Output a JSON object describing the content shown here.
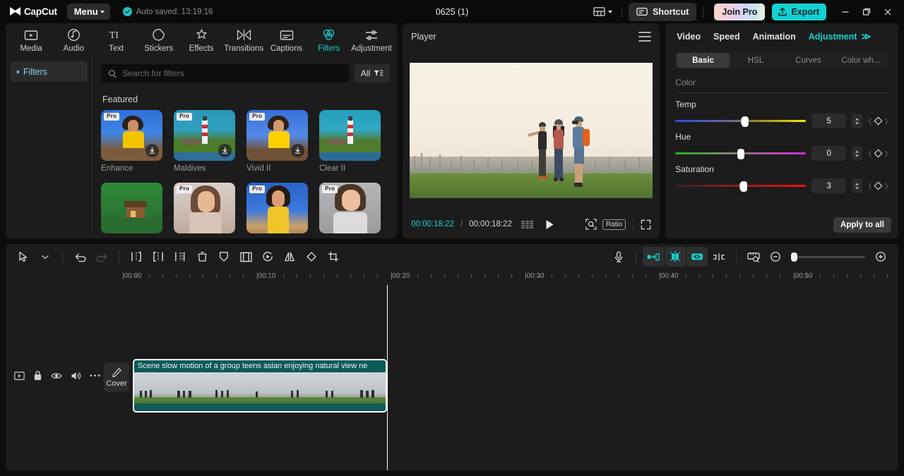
{
  "titlebar": {
    "app_name": "CapCut",
    "menu_label": "Menu",
    "autosave_text": "Auto saved: 13:19:16",
    "project_title": "0625 (1)",
    "layout_icon": "layout-icon",
    "shortcut_label": "Shortcut",
    "join_pro_label": "Join Pro",
    "export_label": "Export",
    "minimize_icon": "minimize-icon",
    "maximize_icon": "maximize-icon",
    "close_icon": "close-icon"
  },
  "left_panel": {
    "tabs": [
      {
        "label": "Media",
        "icon": "media-icon",
        "active": false
      },
      {
        "label": "Audio",
        "icon": "audio-icon",
        "active": false
      },
      {
        "label": "Text",
        "icon": "text-icon",
        "active": false
      },
      {
        "label": "Stickers",
        "icon": "stickers-icon",
        "active": false
      },
      {
        "label": "Effects",
        "icon": "effects-icon",
        "active": false
      },
      {
        "label": "Transitions",
        "icon": "transitions-icon",
        "active": false
      },
      {
        "label": "Captions",
        "icon": "captions-icon",
        "active": false
      },
      {
        "label": "Filters",
        "icon": "filters-icon",
        "active": true
      },
      {
        "label": "Adjustment",
        "icon": "adjustment-icon",
        "active": false
      }
    ],
    "categories": [
      {
        "label": "Filters",
        "active": true
      }
    ],
    "search": {
      "placeholder": "Search for filters",
      "value": ""
    },
    "filter_button": {
      "label": "All",
      "icon": "filter-sort-icon"
    },
    "section_title": "Featured",
    "filters": [
      {
        "name": "Enhance",
        "pro": true,
        "downloadable": true,
        "scene": "sc-portrait-blue"
      },
      {
        "name": "Maldives",
        "pro": true,
        "downloadable": true,
        "scene": "sc-light-house"
      },
      {
        "name": "Vivid II",
        "pro": true,
        "downloadable": true,
        "scene": "sc-portrait-blue2"
      },
      {
        "name": "Clear II",
        "pro": false,
        "downloadable": false,
        "scene": "sc-light-house2"
      },
      {
        "name": "",
        "pro": false,
        "downloadable": false,
        "scene": "sc-forest"
      },
      {
        "name": "",
        "pro": true,
        "downloadable": false,
        "scene": "sc-pale"
      },
      {
        "name": "",
        "pro": true,
        "downloadable": false,
        "scene": "sc-sky-girl"
      },
      {
        "name": "",
        "pro": true,
        "downloadable": false,
        "scene": "sc-gray-girl"
      }
    ]
  },
  "player": {
    "title": "Player",
    "menu_icon": "hamburger-icon",
    "current_time": "00:00:18:22",
    "time_separator": "/",
    "total_time": "00:00:18:22",
    "frames_icon": "frames-icon",
    "play_icon": "play-icon",
    "crop_icon": "zoom-region-icon",
    "ratio_label": "Ratio",
    "fullscreen_icon": "fullscreen-icon"
  },
  "right_panel": {
    "tabs": [
      {
        "label": "Video",
        "active": false
      },
      {
        "label": "Speed",
        "active": false
      },
      {
        "label": "Animation",
        "active": false
      },
      {
        "label": "Adjustment",
        "active": true
      }
    ],
    "more_label": "≫",
    "segments": [
      {
        "label": "Basic",
        "active": true
      },
      {
        "label": "HSL",
        "active": false
      },
      {
        "label": "Curves",
        "active": false
      },
      {
        "label": "Color wh...",
        "active": false
      }
    ],
    "group_label": "Color",
    "sliders": [
      {
        "name": "Temp",
        "value": "5",
        "pct": 52,
        "gradient": "linear-gradient(90deg,#2b4fe0 0%,#6a6a8a 42%,#8a8430 58%,#f2e215 100%)"
      },
      {
        "name": "Hue",
        "value": "0",
        "pct": 50,
        "gradient": "linear-gradient(90deg,#23b523 0%,#8a7a7a 45%,#d42bd4 100%)"
      },
      {
        "name": "Saturation",
        "value": "3",
        "pct": 51,
        "gradient": "linear-gradient(90deg,#3a2020 0%,#8a2020 45%,#f01010 100%)"
      }
    ],
    "apply_to_all_label": "Apply to all"
  },
  "timeline": {
    "tools_left": [
      {
        "icon": "select-arrow-icon",
        "name": "select-tool"
      },
      {
        "icon": "chevron-down-icon",
        "name": "select-dropdown"
      },
      {
        "icon": "undo-icon",
        "name": "undo-button"
      },
      {
        "icon": "redo-icon",
        "name": "redo-button"
      },
      {
        "icon": "split-icon",
        "name": "split-button"
      },
      {
        "icon": "trim-left-icon",
        "name": "delete-left-button"
      },
      {
        "icon": "trim-right-icon",
        "name": "delete-right-button"
      },
      {
        "icon": "delete-icon",
        "name": "delete-button"
      },
      {
        "icon": "freeze-icon",
        "name": "freeze-button"
      },
      {
        "icon": "crop-frame-icon",
        "name": "crop-button"
      },
      {
        "icon": "reverse-icon",
        "name": "reverse-button"
      },
      {
        "icon": "mirror-icon",
        "name": "mirror-button"
      },
      {
        "icon": "rotate-icon",
        "name": "rotate-button"
      },
      {
        "icon": "crop-icon",
        "name": "crop-tool-button"
      }
    ],
    "tools_right": [
      {
        "icon": "microphone-icon",
        "name": "record-button"
      },
      {
        "icon": "keyframe-prev-icon",
        "name": "auto-align-left"
      },
      {
        "icon": "magnet-icon",
        "name": "magnet-toggle"
      },
      {
        "icon": "link-icon",
        "name": "link-toggle"
      },
      {
        "icon": "split-marker-icon",
        "name": "split-marker"
      },
      {
        "icon": "ruler-icon",
        "name": "measure-button"
      },
      {
        "icon": "zoom-out-icon",
        "name": "zoom-out-button"
      },
      {
        "icon": "zoom-in-icon",
        "name": "zoom-in-button"
      }
    ],
    "ruler_labels": [
      "00:00",
      "00:10",
      "00:20",
      "00:30",
      "00:40",
      "00:50"
    ],
    "track_header_icons": [
      {
        "icon": "video-track-icon",
        "name": "track-type-icon"
      },
      {
        "icon": "lock-icon",
        "name": "lock-track-button"
      },
      {
        "icon": "eye-icon",
        "name": "hide-track-button"
      },
      {
        "icon": "volume-icon",
        "name": "mute-track-button"
      },
      {
        "icon": "more-icon",
        "name": "track-more-button"
      }
    ],
    "cover_button": {
      "label": "Cover",
      "icon": "edit-pencil-icon"
    },
    "clip": {
      "title": "Scene slow motion of a group teens asian enjoying natural view ne",
      "frame_count": 7
    },
    "playhead_time": "00:00:18:22"
  },
  "colors": {
    "accent": "#16cfd0",
    "clip_green": "#0d5957",
    "panel_bg": "#1c1c1c",
    "app_bg": "#0d0d0d"
  }
}
